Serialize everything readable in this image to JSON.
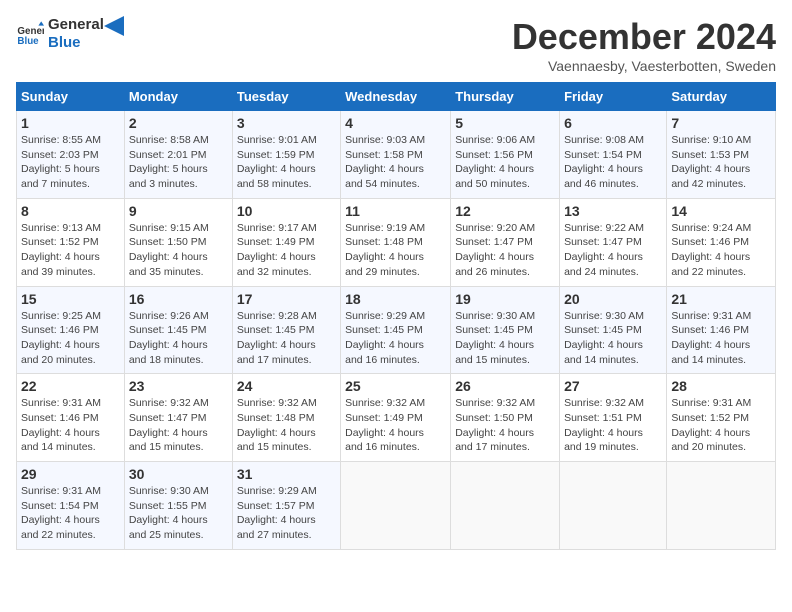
{
  "logo": {
    "text_general": "General",
    "text_blue": "Blue"
  },
  "title": "December 2024",
  "subtitle": "Vaennaesby, Vaesterbotten, Sweden",
  "header_days": [
    "Sunday",
    "Monday",
    "Tuesday",
    "Wednesday",
    "Thursday",
    "Friday",
    "Saturday"
  ],
  "weeks": [
    [
      {
        "day": "1",
        "info": "Sunrise: 8:55 AM\nSunset: 2:03 PM\nDaylight: 5 hours\nand 7 minutes."
      },
      {
        "day": "2",
        "info": "Sunrise: 8:58 AM\nSunset: 2:01 PM\nDaylight: 5 hours\nand 3 minutes."
      },
      {
        "day": "3",
        "info": "Sunrise: 9:01 AM\nSunset: 1:59 PM\nDaylight: 4 hours\nand 58 minutes."
      },
      {
        "day": "4",
        "info": "Sunrise: 9:03 AM\nSunset: 1:58 PM\nDaylight: 4 hours\nand 54 minutes."
      },
      {
        "day": "5",
        "info": "Sunrise: 9:06 AM\nSunset: 1:56 PM\nDaylight: 4 hours\nand 50 minutes."
      },
      {
        "day": "6",
        "info": "Sunrise: 9:08 AM\nSunset: 1:54 PM\nDaylight: 4 hours\nand 46 minutes."
      },
      {
        "day": "7",
        "info": "Sunrise: 9:10 AM\nSunset: 1:53 PM\nDaylight: 4 hours\nand 42 minutes."
      }
    ],
    [
      {
        "day": "8",
        "info": "Sunrise: 9:13 AM\nSunset: 1:52 PM\nDaylight: 4 hours\nand 39 minutes."
      },
      {
        "day": "9",
        "info": "Sunrise: 9:15 AM\nSunset: 1:50 PM\nDaylight: 4 hours\nand 35 minutes."
      },
      {
        "day": "10",
        "info": "Sunrise: 9:17 AM\nSunset: 1:49 PM\nDaylight: 4 hours\nand 32 minutes."
      },
      {
        "day": "11",
        "info": "Sunrise: 9:19 AM\nSunset: 1:48 PM\nDaylight: 4 hours\nand 29 minutes."
      },
      {
        "day": "12",
        "info": "Sunrise: 9:20 AM\nSunset: 1:47 PM\nDaylight: 4 hours\nand 26 minutes."
      },
      {
        "day": "13",
        "info": "Sunrise: 9:22 AM\nSunset: 1:47 PM\nDaylight: 4 hours\nand 24 minutes."
      },
      {
        "day": "14",
        "info": "Sunrise: 9:24 AM\nSunset: 1:46 PM\nDaylight: 4 hours\nand 22 minutes."
      }
    ],
    [
      {
        "day": "15",
        "info": "Sunrise: 9:25 AM\nSunset: 1:46 PM\nDaylight: 4 hours\nand 20 minutes."
      },
      {
        "day": "16",
        "info": "Sunrise: 9:26 AM\nSunset: 1:45 PM\nDaylight: 4 hours\nand 18 minutes."
      },
      {
        "day": "17",
        "info": "Sunrise: 9:28 AM\nSunset: 1:45 PM\nDaylight: 4 hours\nand 17 minutes."
      },
      {
        "day": "18",
        "info": "Sunrise: 9:29 AM\nSunset: 1:45 PM\nDaylight: 4 hours\nand 16 minutes."
      },
      {
        "day": "19",
        "info": "Sunrise: 9:30 AM\nSunset: 1:45 PM\nDaylight: 4 hours\nand 15 minutes."
      },
      {
        "day": "20",
        "info": "Sunrise: 9:30 AM\nSunset: 1:45 PM\nDaylight: 4 hours\nand 14 minutes."
      },
      {
        "day": "21",
        "info": "Sunrise: 9:31 AM\nSunset: 1:46 PM\nDaylight: 4 hours\nand 14 minutes."
      }
    ],
    [
      {
        "day": "22",
        "info": "Sunrise: 9:31 AM\nSunset: 1:46 PM\nDaylight: 4 hours\nand 14 minutes."
      },
      {
        "day": "23",
        "info": "Sunrise: 9:32 AM\nSunset: 1:47 PM\nDaylight: 4 hours\nand 15 minutes."
      },
      {
        "day": "24",
        "info": "Sunrise: 9:32 AM\nSunset: 1:48 PM\nDaylight: 4 hours\nand 15 minutes."
      },
      {
        "day": "25",
        "info": "Sunrise: 9:32 AM\nSunset: 1:49 PM\nDaylight: 4 hours\nand 16 minutes."
      },
      {
        "day": "26",
        "info": "Sunrise: 9:32 AM\nSunset: 1:50 PM\nDaylight: 4 hours\nand 17 minutes."
      },
      {
        "day": "27",
        "info": "Sunrise: 9:32 AM\nSunset: 1:51 PM\nDaylight: 4 hours\nand 19 minutes."
      },
      {
        "day": "28",
        "info": "Sunrise: 9:31 AM\nSunset: 1:52 PM\nDaylight: 4 hours\nand 20 minutes."
      }
    ],
    [
      {
        "day": "29",
        "info": "Sunrise: 9:31 AM\nSunset: 1:54 PM\nDaylight: 4 hours\nand 22 minutes."
      },
      {
        "day": "30",
        "info": "Sunrise: 9:30 AM\nSunset: 1:55 PM\nDaylight: 4 hours\nand 25 minutes."
      },
      {
        "day": "31",
        "info": "Sunrise: 9:29 AM\nSunset: 1:57 PM\nDaylight: 4 hours\nand 27 minutes."
      },
      null,
      null,
      null,
      null
    ]
  ]
}
